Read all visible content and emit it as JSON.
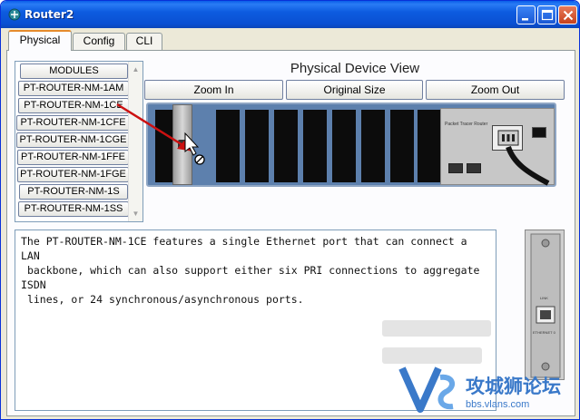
{
  "window": {
    "title": "Router2"
  },
  "tabs": [
    {
      "label": "Physical",
      "active": true
    },
    {
      "label": "Config",
      "active": false
    },
    {
      "label": "CLI",
      "active": false
    }
  ],
  "modules": {
    "header": "MODULES",
    "items": [
      "PT-ROUTER-NM-1AM",
      "PT-ROUTER-NM-1CE",
      "PT-ROUTER-NM-1CFE",
      "PT-ROUTER-NM-1CGE",
      "PT-ROUTER-NM-1FFE",
      "PT-ROUTER-NM-1FGE",
      "PT-ROUTER-NM-1S",
      "PT-ROUTER-NM-1SS"
    ]
  },
  "device_view": {
    "title": "Physical Device View",
    "zoom_in_label": "Zoom In",
    "original_size_label": "Original Size",
    "zoom_out_label": "Zoom Out",
    "chassis_label": "Packet Tracer Router"
  },
  "description": {
    "text": "The PT-ROUTER-NM-1CE features a single Ethernet port that can connect a LAN\n backbone, which can also support either six PRI connections to aggregate ISDN\n lines, or 24 synchronous/asynchronous ports."
  },
  "module_preview": {
    "link_label": "LINK",
    "port_label": "ETHERNET 0"
  },
  "watermark": {
    "text": "攻城狮论坛",
    "url": "bbs.vlans.com"
  },
  "colors": {
    "title_bar": "#0a4fd2",
    "tab_highlight": "#e68b2c",
    "device_background": "#5d80ad",
    "watermark": "#3a79c9",
    "drag_arrow": "#cc1111"
  }
}
